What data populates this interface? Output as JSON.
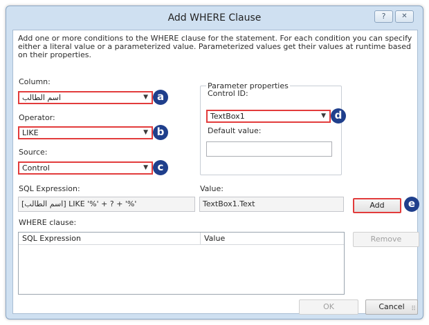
{
  "dialog": {
    "title": "Add WHERE Clause",
    "help_glyph": "?",
    "close_glyph": "✕",
    "description": "Add one or more conditions to the WHERE clause for the statement. For each condition you can specify either a literal value or a parameterized value. Parameterized values get their values at runtime based on their properties."
  },
  "column": {
    "label": "Column:",
    "value": "اسم الطالب"
  },
  "operator": {
    "label": "Operator:",
    "value": "LIKE"
  },
  "source": {
    "label": "Source:",
    "value": "Control"
  },
  "parameter_properties": {
    "title": "Parameter properties",
    "control_id_label": "Control ID:",
    "control_id_value": "TextBox1",
    "default_value_label": "Default value:",
    "default_value": ""
  },
  "sql_expression": {
    "label": "SQL Expression:",
    "value": "[اسم الطالب] LIKE '%' + ? + '%'"
  },
  "value": {
    "label": "Value:",
    "value": "TextBox1.Text"
  },
  "buttons": {
    "add": "Add",
    "remove": "Remove",
    "ok": "OK",
    "cancel": "Cancel"
  },
  "where_clause": {
    "label": "WHERE clause:",
    "columns": [
      "SQL Expression",
      "Value"
    ],
    "rows": []
  },
  "callouts": {
    "a": "a",
    "b": "b",
    "c": "c",
    "d": "d",
    "e": "e"
  },
  "colors": {
    "highlight": "#e23b3b",
    "callout": "#1f3f8c",
    "window_frame": "#cfe0f1"
  }
}
